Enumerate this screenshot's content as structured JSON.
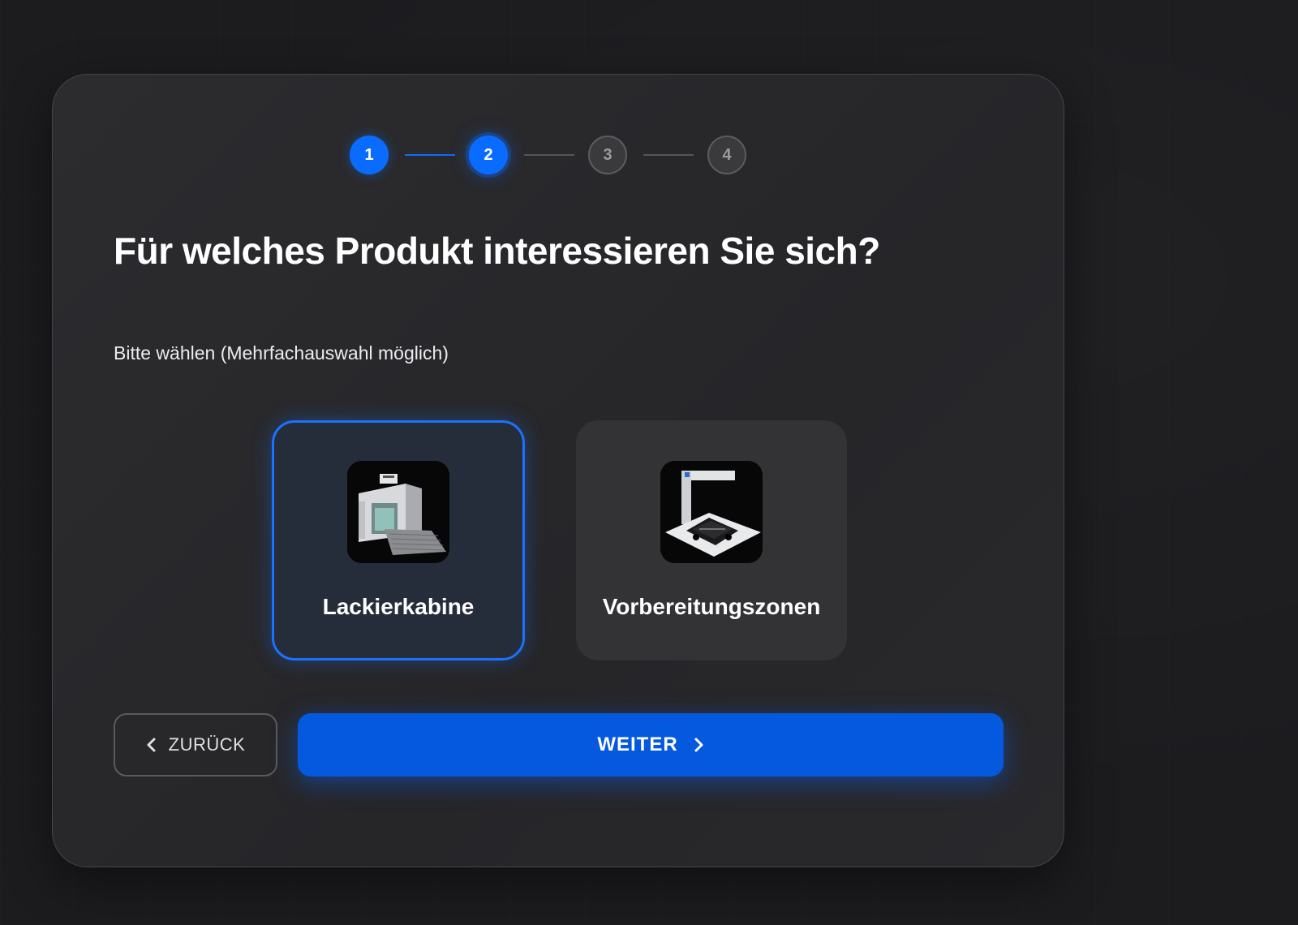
{
  "stepper": {
    "steps": [
      {
        "label": "1",
        "state": "done"
      },
      {
        "label": "2",
        "state": "active"
      },
      {
        "label": "3",
        "state": "todo"
      },
      {
        "label": "4",
        "state": "todo"
      }
    ]
  },
  "question": {
    "title": "Für welches Produkt interessieren Sie sich?",
    "subtitle": "Bitte wählen (Mehrfachauswahl möglich)"
  },
  "options": [
    {
      "label": "Lackierkabine",
      "selected": true,
      "icon": "paint-booth-image"
    },
    {
      "label": "Vorbereitungszonen",
      "selected": false,
      "icon": "preparation-zone-image"
    }
  ],
  "nav": {
    "back_label": "ZURÜCK",
    "next_label": "WEITER"
  },
  "colors": {
    "accent": "#0a6cff",
    "button_primary": "#0459de",
    "background": "#1c1c1f",
    "card": "#2a2a2d"
  }
}
